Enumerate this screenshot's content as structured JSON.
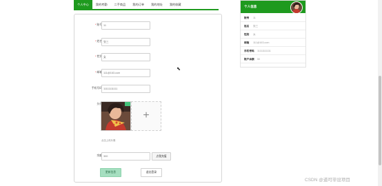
{
  "tabs": [
    "个人中心",
    "我的考勤",
    "二手商品",
    "我的订单",
    "我的地址",
    "我的收藏"
  ],
  "form": {
    "account": {
      "label": "账号",
      "value": "11"
    },
    "name": {
      "label": "姓名",
      "value": "张三"
    },
    "gender": {
      "label": "性别",
      "value": "女"
    },
    "email": {
      "label": "邮箱",
      "value": "111@163.com"
    },
    "phone": {
      "label": "手机号码",
      "value": "11111111111"
    },
    "avatar_label": "头像",
    "avatar_tip": "点击上传头像",
    "balance": {
      "label": "余额",
      "value": "300"
    },
    "recharge_label": "点我充值",
    "update_label": "更新信息",
    "logout_label": "退出登录"
  },
  "profile": {
    "title": "个人信息",
    "rows": [
      {
        "k": "账号",
        "v": "11"
      },
      {
        "k": "姓名",
        "v": "张三"
      },
      {
        "k": "性别",
        "v": "女"
      },
      {
        "k": "邮箱",
        "v": "111@163.com"
      },
      {
        "k": "手机号码",
        "v": "11111111111"
      },
      {
        "k": "账户余额",
        "v": "50"
      }
    ]
  },
  "watermark": "CSDN @道可毕设项目"
}
